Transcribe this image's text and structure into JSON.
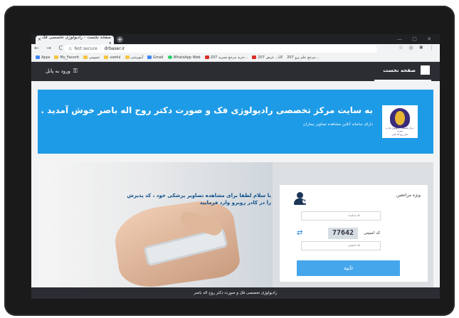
{
  "browser": {
    "tab_title": "صفحه نخست - رادیولوژی تخصصی فک و",
    "tab_close": "×",
    "new_tab": "+",
    "window_controls": "— ▢ ✕",
    "nav": "← → C",
    "security_label": "Not secure",
    "url": "drbaser.ir",
    "extras": "☆ ◎ ✱ ⋮",
    "bookmarks": [
      "Apps",
      "My_Favorit",
      "عمومی",
      "useful",
      "آموزشی",
      "Gmail",
      "WhatsApp Web",
      "خرید مرجع تسرید 207...",
      "غرض 207 ...LE",
      "مرجع علم پرو 207..."
    ]
  },
  "site": {
    "nav_home": "صفحه نخست",
    "login_label": "ورود به پانل",
    "banner_title": "به سایت مرکز تخصصی رادیولوژی فک و صورت دکتر روح اله باصر خوش آمدید .",
    "banner_subtitle": "دارای سامانه آنلاین مشاهده تصاویر بیماران",
    "logo_text1": "مرکز تخصصی رادیولوژی فک و صورت",
    "logo_text2": "دکتر روح اله باصر",
    "photo_text": "با سلام لطفا برای مشاهده تصاویر پزشکی خود ، کد پذیرش را در کادر روبرو وارد فرمایید",
    "form": {
      "title": "ویژه مراجعین",
      "site_code_placeholder": "کد سایت",
      "captcha_label": "کد امنیتی",
      "captcha_value": "77642",
      "security_placeholder": "کد امنیتی",
      "submit_label": "تایید"
    },
    "footer": "رادیولوژی تخصصی فک و صورت دکتر روح اله باصر"
  },
  "colors": {
    "banner": "#1e9be6",
    "header": "#2b2d33",
    "button": "#45a6ec"
  }
}
